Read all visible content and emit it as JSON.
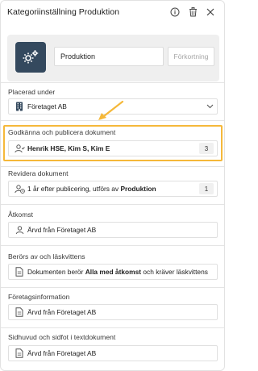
{
  "header": {
    "title": "Kategoriinställning Produktion",
    "info_icon": "info-icon",
    "delete_icon": "trash-icon"
  },
  "topcard": {
    "icon": "gears-icon",
    "name_value": "Produktion",
    "abbr_placeholder": "Förkortning",
    "icon_bg": "#34495e"
  },
  "placed_under": {
    "label": "Placerad under",
    "value": "Företaget AB",
    "icon": "building-icon"
  },
  "approve": {
    "label": "Godkänna och publicera dokument",
    "value": "Henrik HSE, Kim S, Kim E",
    "count": "3",
    "icon": "user-approve-icon"
  },
  "revise": {
    "label": "Revidera dokument",
    "value_prefix": "1 år efter publicering, utförs av ",
    "value_bold": "Produktion",
    "count": "1",
    "icon": "user-clock-icon"
  },
  "access": {
    "label": "Åtkomst",
    "value": "Ärvd från Företaget AB",
    "icon": "user-icon"
  },
  "affected": {
    "label": "Berörs av och läskvittens",
    "value_prefix": "Dokumenten berör ",
    "value_bold": "Alla med åtkomst",
    "value_suffix": " och kräver läskvittens",
    "icon": "document-icon"
  },
  "company_info": {
    "label": "Företagsinformation",
    "value": "Ärvd från Företaget AB",
    "icon": "document-icon"
  },
  "header_footer": {
    "label": "Sidhuvud och sidfot i textdokument",
    "value": "Ärvd från Företaget AB",
    "icon": "document-icon"
  },
  "colors": {
    "highlight": "#f5b83a",
    "gear_box": "#34495e"
  }
}
